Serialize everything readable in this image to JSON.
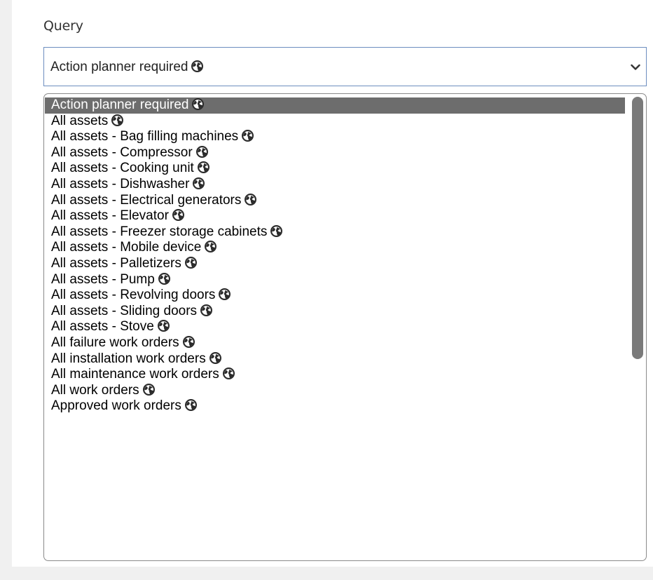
{
  "query": {
    "label": "Query",
    "selected_value": "Action planner required",
    "options": [
      {
        "label": "Action planner required",
        "selected": true,
        "icon": "globe-icon"
      },
      {
        "label": "All assets",
        "icon": "globe-icon"
      },
      {
        "label": "All assets - Bag filling machines",
        "icon": "globe-icon"
      },
      {
        "label": "All assets - Compressor",
        "icon": "globe-icon"
      },
      {
        "label": "All assets - Cooking unit",
        "icon": "globe-icon"
      },
      {
        "label": "All assets - Dishwasher",
        "icon": "globe-icon"
      },
      {
        "label": "All assets - Electrical generators",
        "icon": "globe-icon"
      },
      {
        "label": "All assets - Elevator",
        "icon": "globe-icon"
      },
      {
        "label": "All assets - Freezer storage cabinets",
        "icon": "globe-icon"
      },
      {
        "label": "All assets - Mobile device",
        "icon": "globe-icon"
      },
      {
        "label": "All assets - Palletizers",
        "icon": "globe-icon"
      },
      {
        "label": "All assets - Pump",
        "icon": "globe-icon"
      },
      {
        "label": "All assets - Revolving doors",
        "icon": "globe-icon"
      },
      {
        "label": "All assets - Sliding doors",
        "icon": "globe-icon"
      },
      {
        "label": "All assets - Stove",
        "icon": "globe-icon"
      },
      {
        "label": "All failure work orders",
        "icon": "globe-icon"
      },
      {
        "label": "All installation work orders",
        "icon": "globe-icon"
      },
      {
        "label": "All maintenance work orders",
        "icon": "globe-icon"
      },
      {
        "label": "All work orders",
        "icon": "globe-icon"
      },
      {
        "label": "Approved work orders",
        "icon": "globe-icon"
      }
    ],
    "scroll": {
      "position": 0.0,
      "visible_fraction": 0.57
    }
  },
  "colors": {
    "selected_bg": "#6d6d6d",
    "selected_text": "#ffffff",
    "select_border": "#6c8ebf",
    "page_bg": "#f0f0f0",
    "scrollbar_thumb": "#7a7a7a"
  }
}
